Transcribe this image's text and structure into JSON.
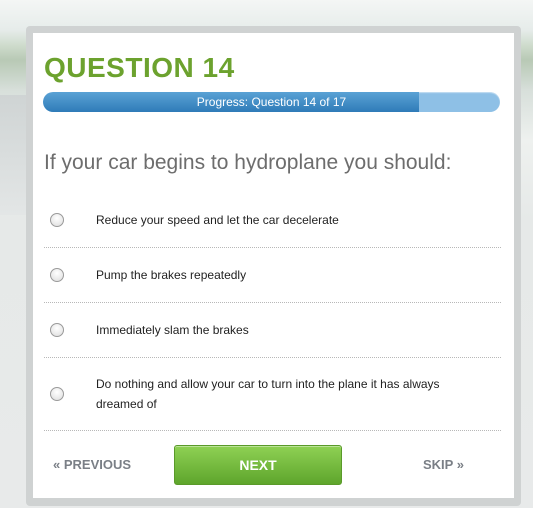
{
  "quiz": {
    "title": "QUESTION 14",
    "progress": {
      "text": "Progress: Question 14 of 17",
      "fraction": 0.8235
    },
    "prompt": "If your car begins to hydroplane you should:",
    "options": [
      {
        "label": "Reduce your speed and let the car decelerate"
      },
      {
        "label": "Pump the brakes repeatedly"
      },
      {
        "label": "Immediately slam the brakes"
      },
      {
        "label": "Do nothing and allow your car to turn into the plane it has always dreamed of"
      }
    ],
    "nav": {
      "previous": "« PREVIOUS",
      "next": "NEXT",
      "skip": "SKIP »"
    }
  },
  "colors": {
    "accent_green": "#6ca22e",
    "progress_blue": "#2f7bb8",
    "progress_light": "#8ec0e6",
    "next_button": "#6fb83a",
    "nav_gray": "#7a7f86"
  }
}
